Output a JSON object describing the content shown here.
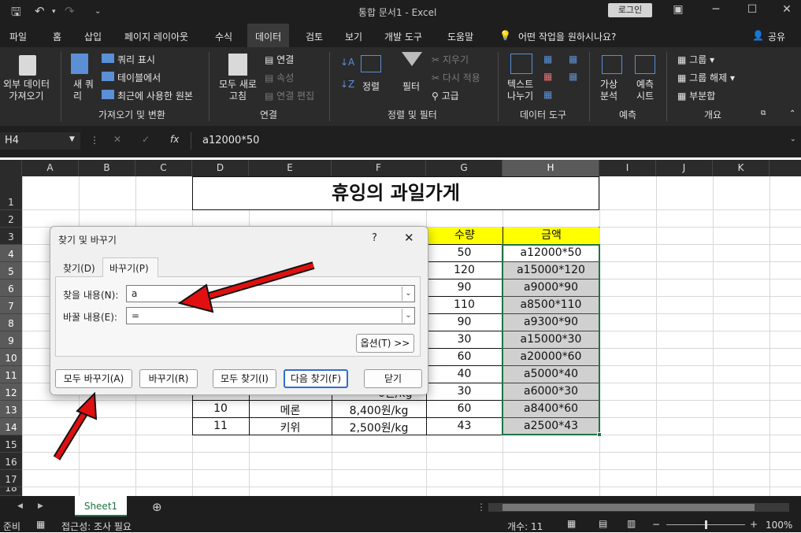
{
  "title_bar": {
    "title": "통합 문서1  -  Excel",
    "login": "로그인"
  },
  "tabs": [
    "파일",
    "홈",
    "삽입",
    "페이지 레이아웃",
    "수식",
    "데이터",
    "검토",
    "보기",
    "개발 도구",
    "도움말"
  ],
  "tell_me": "어떤 작업을 원하시나요?",
  "share": "공유",
  "ribbon": {
    "external_data": "외부 데이터\n가져오기",
    "new_query": "새 쿼\n리",
    "show_query": "쿼리 표시",
    "from_table": "테이블에서",
    "recent_sources": "최근에 사용한 원본",
    "group_get_transform": "가져오기 및 변환",
    "refresh_all": "모두 새로\n고침",
    "connections": "연결",
    "properties": "속성",
    "edit_links": "연결 편집",
    "group_connections": "연결",
    "sort": "정렬",
    "filter": "필터",
    "clear": "지우기",
    "reapply": "다시 적용",
    "advanced": "고급",
    "group_sort_filter": "정렬 및 필터",
    "text_to_columns": "텍스트\n나누기",
    "group_data_tools": "데이터 도구",
    "what_if": "가상\n분석",
    "forecast_sheet": "예측\n시트",
    "group_forecast": "예측",
    "group": "그룹",
    "ungroup": "그룹 해제",
    "subtotal": "부분합",
    "group_outline": "개요"
  },
  "formula_bar": {
    "name_box": "H4",
    "formula": "a12000*50"
  },
  "columns": [
    "A",
    "B",
    "C",
    "D",
    "E",
    "F",
    "G",
    "H",
    "I",
    "J",
    "K"
  ],
  "rows": [
    "1",
    "2",
    "3",
    "4",
    "5",
    "6",
    "7",
    "8",
    "9",
    "10",
    "11",
    "12",
    "13",
    "14",
    "15",
    "16",
    "17",
    "18"
  ],
  "sheet": {
    "title": "휴잉의 과일가게",
    "header_qty": "수량",
    "header_amount": "금액",
    "qty": [
      "50",
      "120",
      "90",
      "110",
      "90",
      "30",
      "60",
      "40",
      "30",
      "60",
      "43"
    ],
    "amount": [
      "a12000*50",
      "a15000*120",
      "a9000*90",
      "a8500*110",
      "a9300*90",
      "a15000*30",
      "a20000*60",
      "a5000*40",
      "a6000*30",
      "a8400*60",
      "a2500*43"
    ],
    "visible_rows": [
      {
        "no": "10",
        "fruit": "메론",
        "price": "8,400원/kg"
      },
      {
        "no": "11",
        "fruit": "키위",
        "price": "2,500원/kg"
      }
    ],
    "partial_price_row12": "0원/kg"
  },
  "dialog": {
    "title": "찾기 및 바꾸기",
    "help": "?",
    "tab_find": "찾기(D)",
    "tab_replace": "바꾸기(P)",
    "find_label": "찾을 내용(N):",
    "find_value": "a",
    "replace_label": "바꿀 내용(E):",
    "replace_value": "=",
    "options": "옵션(T) >>",
    "replace_all": "모두 바꾸기(A)",
    "replace": "바꾸기(R)",
    "find_all": "모두 찾기(I)",
    "find_next": "다음 찾기(F)",
    "close": "닫기"
  },
  "sheet_tab": "Sheet1",
  "status": {
    "ready": "준비",
    "accessibility": "접근성: 조사 필요",
    "count": "개수: 11",
    "zoom": "100%"
  },
  "colors": {
    "header_yellow": "#ffff00",
    "selection_green": "#217346",
    "arrow_red": "#e01010"
  }
}
